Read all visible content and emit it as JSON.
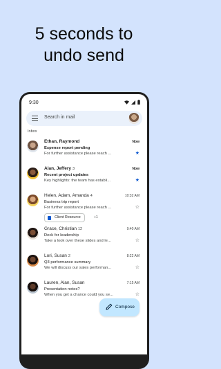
{
  "headline": {
    "line1": "5 seconds to",
    "line2": "undo send"
  },
  "status_bar": {
    "time": "9:30"
  },
  "search": {
    "placeholder": "Search in mail"
  },
  "inbox_label": "Inbox",
  "emails": [
    {
      "sender": "Ethan, Raymond",
      "count": "",
      "date": "Now",
      "subject": "Expense report pending",
      "snippet": "For further assistance please reach ...",
      "starred": true,
      "unread": true
    },
    {
      "sender": "Alan, Jeffery",
      "count": "3",
      "date": "Now",
      "subject": "Recent project updates",
      "snippet": "Key highlights: the team has establi...",
      "starred": true,
      "unread": true
    },
    {
      "sender": "Helen, Adam, Amanda",
      "count": "4",
      "date": "10:32 AM",
      "subject": "Business trip report",
      "snippet": "For further assistance please reach ...",
      "starred": false,
      "unread": false,
      "attachment": "Client Resource",
      "attachment_more": "+1"
    },
    {
      "sender": "Grace, Christian",
      "count": "12",
      "date": "9:40 AM",
      "subject": "Deck for leadership",
      "snippet": "Take a look over these slides and le...",
      "starred": false,
      "unread": false
    },
    {
      "sender": "Lori, Susan",
      "count": "2",
      "date": "8:22 AM",
      "subject": "Q3 performance summary",
      "snippet": "We will discuss our sales performan...",
      "starred": false,
      "unread": false
    },
    {
      "sender": "Lauren, Alan, Susan",
      "count": "",
      "date": "7:15 AM",
      "subject": "Presentation notes?",
      "snippet": "When you get a chance could you se...",
      "starred": false,
      "unread": false
    }
  ],
  "compose": {
    "label": "Compose"
  },
  "colors": {
    "background": "#d3e3fd",
    "accent": "#0b57d0",
    "compose_bg": "#c2e7ff"
  }
}
